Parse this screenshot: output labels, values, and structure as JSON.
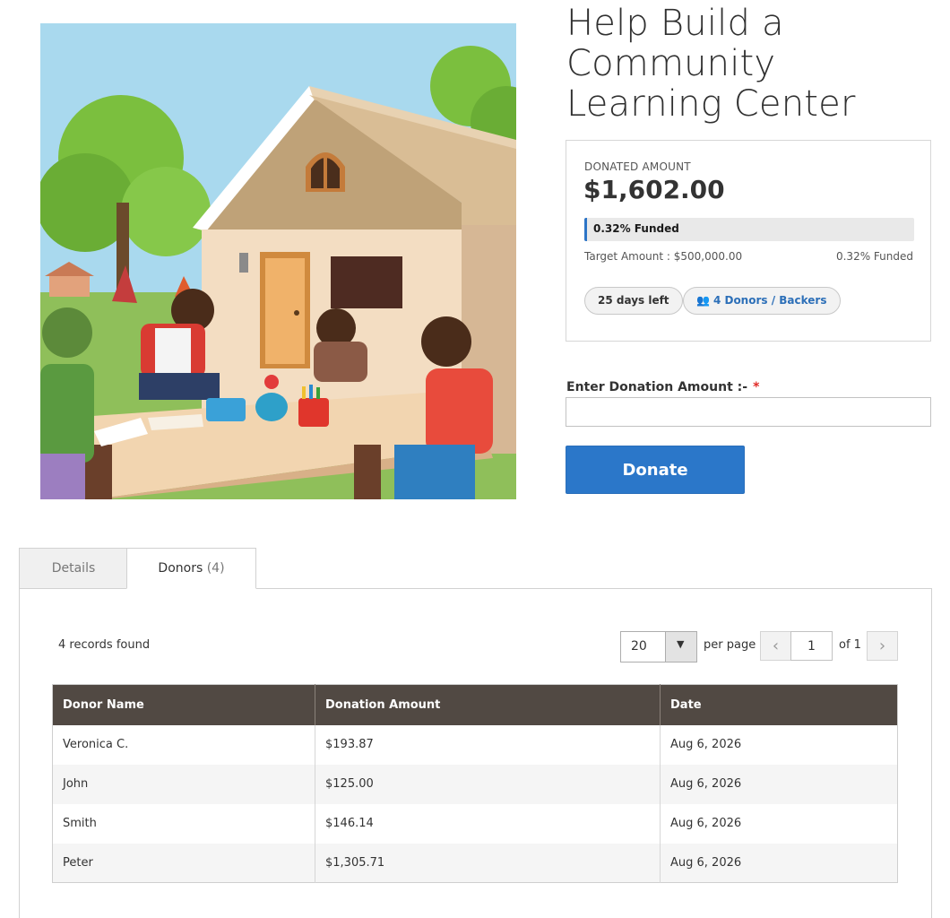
{
  "product": {
    "title": "Help Build a Community Learning Center",
    "image_alt": "Children studying at a table outside a community house"
  },
  "funding": {
    "donated_label": "DONATED AMOUNT",
    "donated_value": "$1,602.00",
    "progress_percent": 0.32,
    "progress_label": "0.32% Funded",
    "target_text": "Target Amount : $500,000.00",
    "funded_text": "0.32% Funded",
    "days_left": "25 days left",
    "donors_backers": "4 Donors / Backers",
    "donors_icon": "users-icon",
    "accent_color": "#2c74c6"
  },
  "donation_form": {
    "amount_label": "Enter Donation Amount :-",
    "required_mark": "*",
    "amount_value": "",
    "donate_label": "Donate"
  },
  "tabs": [
    {
      "label": "Details",
      "active": false
    },
    {
      "label": "Donors",
      "count": "(4)",
      "active": true
    }
  ],
  "donors_panel": {
    "records_found": "4 records found",
    "limiter_value": "20",
    "limiter_icon": "caret-down-icon",
    "per_page_label": "per page",
    "current_page": "1",
    "of_pages": "of 1",
    "prev_icon": "chevron-left-icon",
    "next_icon": "chevron-right-icon",
    "columns": [
      "Donor Name",
      "Donation Amount",
      "Date"
    ],
    "rows": [
      {
        "name": "Veronica C.",
        "amount": "$193.87",
        "date": "Aug 6, 2026"
      },
      {
        "name": "John",
        "amount": "$125.00",
        "date": "Aug 6, 2026"
      },
      {
        "name": "Smith",
        "amount": "$146.14",
        "date": "Aug 6, 2026"
      },
      {
        "name": "Peter",
        "amount": "$1,305.71",
        "date": "Aug 6, 2026"
      }
    ]
  }
}
